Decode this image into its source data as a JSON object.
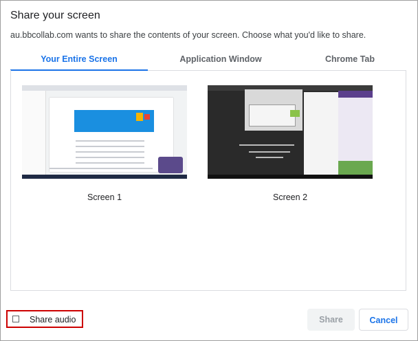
{
  "dialog": {
    "title": "Share your screen",
    "description": "au.bbcollab.com wants to share the contents of your screen. Choose what you'd like to share."
  },
  "tabs": [
    {
      "label": "Your Entire Screen",
      "active": true
    },
    {
      "label": "Application Window",
      "active": false
    },
    {
      "label": "Chrome Tab",
      "active": false
    }
  ],
  "screens": [
    {
      "label": "Screen 1",
      "icon": "screen-thumbnail"
    },
    {
      "label": "Screen 2",
      "icon": "screen-thumbnail"
    }
  ],
  "audio": {
    "label": "Share audio",
    "checked": false
  },
  "buttons": {
    "share": "Share",
    "cancel": "Cancel"
  },
  "colors": {
    "accent": "#1a73e8",
    "highlight_border": "#cc0000"
  }
}
